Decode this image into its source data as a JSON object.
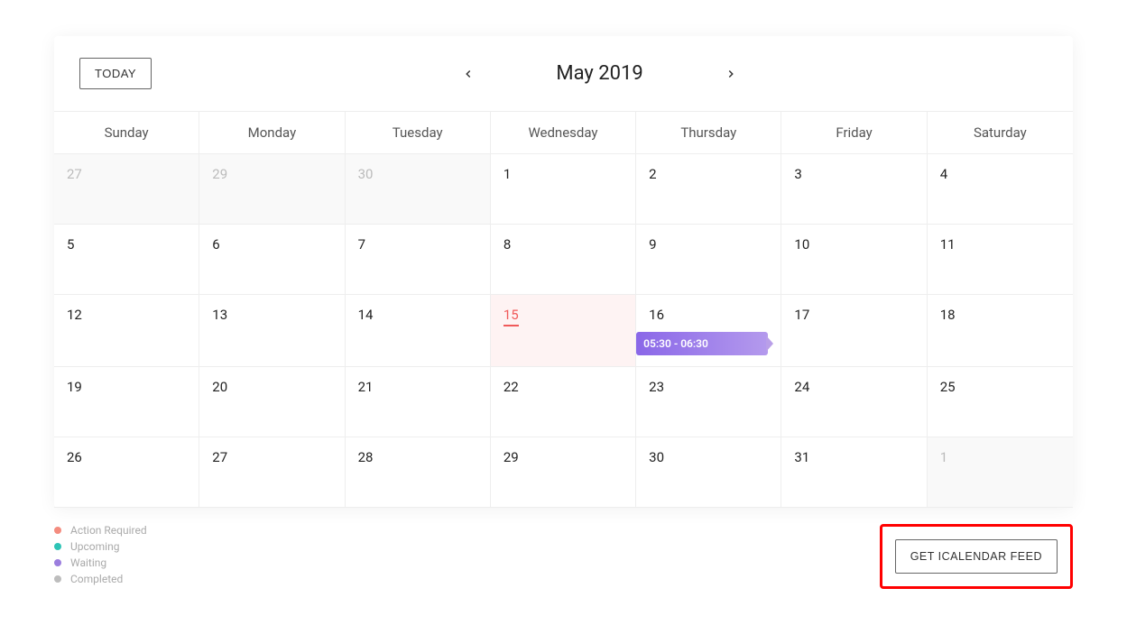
{
  "header": {
    "today_label": "TODAY",
    "month_title": "May 2019"
  },
  "weekdays": [
    "Sunday",
    "Monday",
    "Tuesday",
    "Wednesday",
    "Thursday",
    "Friday",
    "Saturday"
  ],
  "days": [
    {
      "n": "27",
      "other": true
    },
    {
      "n": "29",
      "other": true
    },
    {
      "n": "30",
      "other": true
    },
    {
      "n": "1"
    },
    {
      "n": "2"
    },
    {
      "n": "3"
    },
    {
      "n": "4"
    },
    {
      "n": "5"
    },
    {
      "n": "6"
    },
    {
      "n": "7"
    },
    {
      "n": "8"
    },
    {
      "n": "9"
    },
    {
      "n": "10"
    },
    {
      "n": "11"
    },
    {
      "n": "12"
    },
    {
      "n": "13"
    },
    {
      "n": "14"
    },
    {
      "n": "15",
      "today": true
    },
    {
      "n": "16",
      "event": "05:30 - 06:30"
    },
    {
      "n": "17"
    },
    {
      "n": "18"
    },
    {
      "n": "19"
    },
    {
      "n": "20"
    },
    {
      "n": "21"
    },
    {
      "n": "22"
    },
    {
      "n": "23"
    },
    {
      "n": "24"
    },
    {
      "n": "25"
    },
    {
      "n": "26"
    },
    {
      "n": "27"
    },
    {
      "n": "28"
    },
    {
      "n": "29"
    },
    {
      "n": "30"
    },
    {
      "n": "31"
    },
    {
      "n": "1",
      "other": true
    }
  ],
  "legend": [
    {
      "label": "Action Required",
      "color": "#f48c7f"
    },
    {
      "label": "Upcoming",
      "color": "#2ec4b6"
    },
    {
      "label": "Waiting",
      "color": "#9b7ede"
    },
    {
      "label": "Completed",
      "color": "#bdbdbd"
    }
  ],
  "footer": {
    "feed_label": "GET ICALENDAR FEED"
  }
}
